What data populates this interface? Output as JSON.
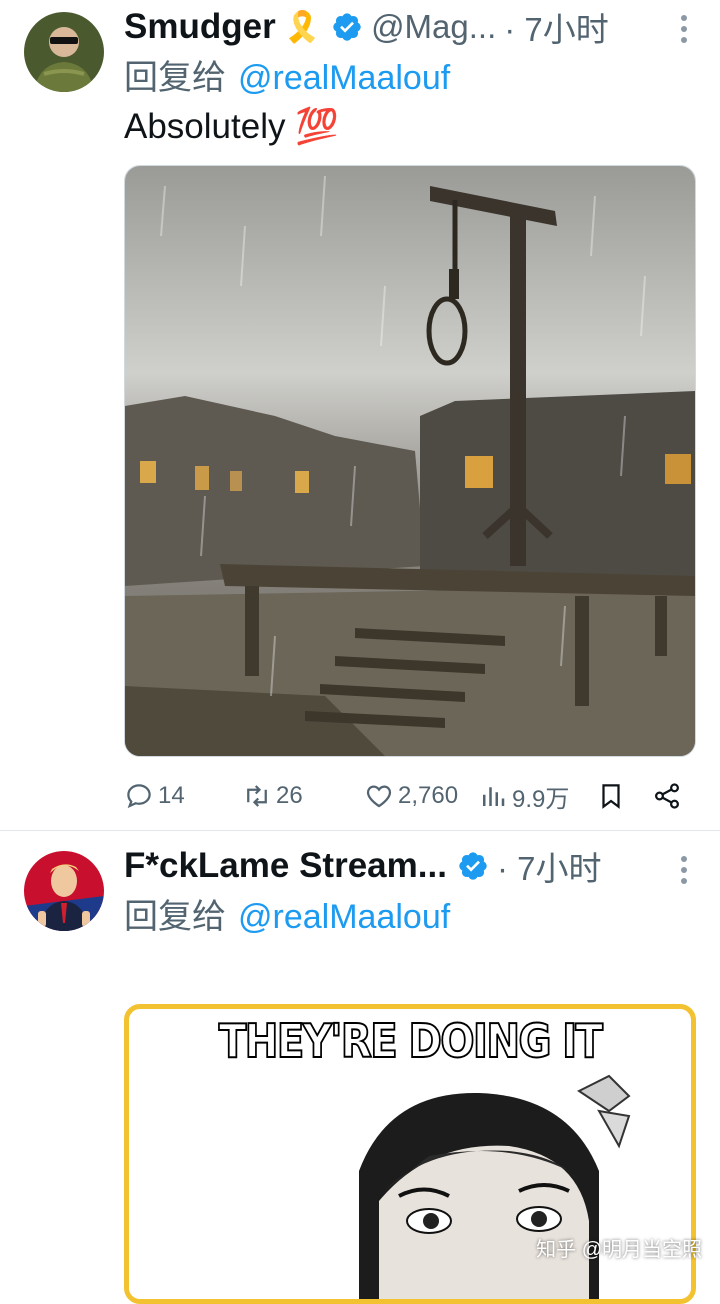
{
  "tweets": [
    {
      "author": "Smudger",
      "badge_emoji": "🎗️",
      "handle": "@Mag...",
      "time": "· 7小时",
      "reply_prefix": "回复给",
      "reply_to": "@realMaalouf",
      "text": "Absolutely 💯",
      "media_description": "gallows with noose in rainy village square",
      "actions": {
        "replies": "14",
        "reposts": "26",
        "likes": "2,760",
        "views": "9.9万"
      }
    },
    {
      "author": "F*ckLame Stream...",
      "time": "· 7小时",
      "reply_prefix": "回复给",
      "reply_to": "@realMaalouf",
      "meme_caption": "THEY'RE DOING IT AGAIN"
    }
  ],
  "watermark": "知乎 @明月当空照",
  "colors": {
    "text": "#0f1419",
    "secondary": "#536471",
    "link": "#1d9bf0",
    "verified": "#1d9bf0",
    "meme_border": "#f2c230"
  }
}
